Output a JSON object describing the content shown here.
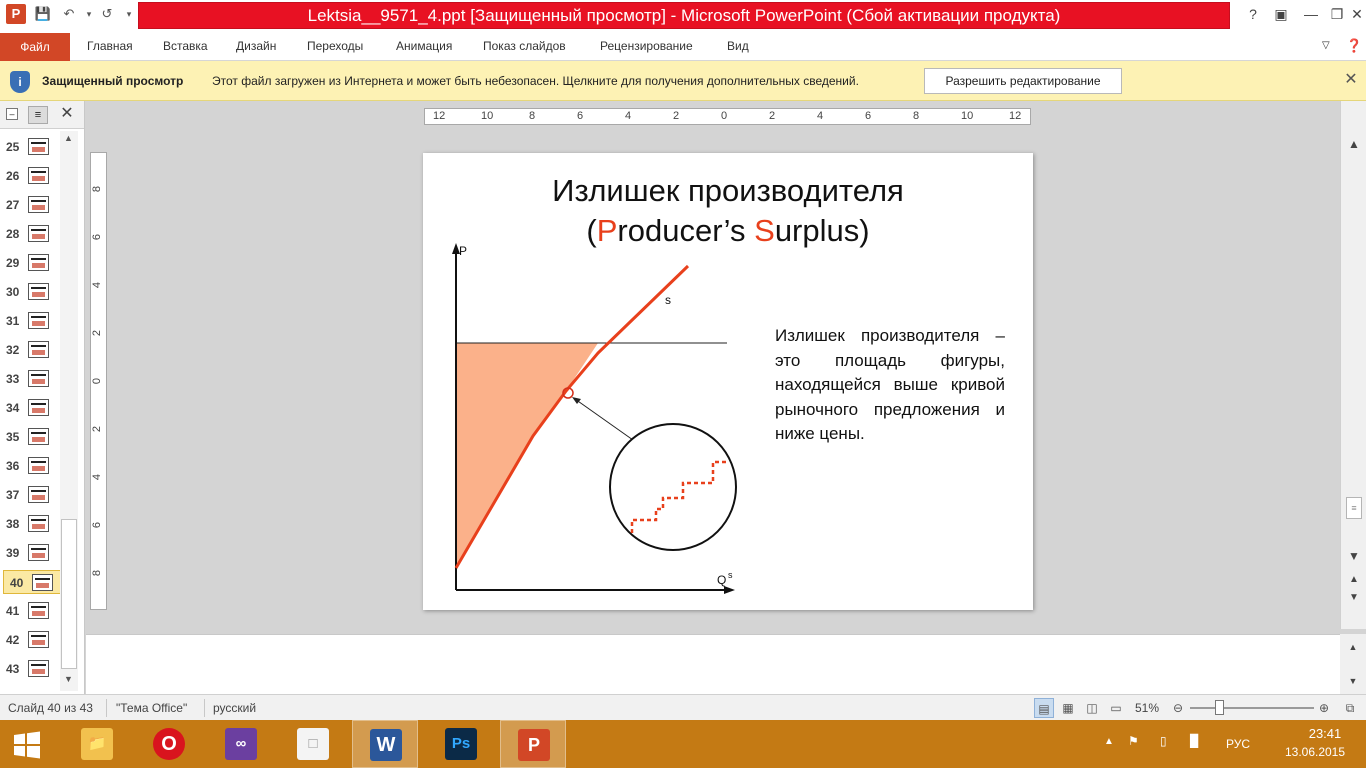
{
  "window": {
    "title": "Lektsia__9571_4.ppt [Защищенный просмотр] - Microsoft PowerPoint (Сбой активации продукта)",
    "app_icon_letter": "P"
  },
  "ribbon": {
    "file_tab": "Файл",
    "tabs": [
      "Главная",
      "Вставка",
      "Дизайн",
      "Переходы",
      "Анимация",
      "Показ слайдов",
      "Рецензирование",
      "Вид"
    ]
  },
  "protected_view": {
    "title": "Защищенный просмотр",
    "message": "Этот файл загружен из Интернета и может быть небезопасен. Щелкните для получения дополнительных сведений.",
    "button": "Разрешить редактирование"
  },
  "thumbnails": {
    "numbers": [
      "25",
      "26",
      "27",
      "28",
      "29",
      "30",
      "31",
      "32",
      "33",
      "34",
      "35",
      "36",
      "37",
      "38",
      "39",
      "40",
      "41",
      "42",
      "43"
    ],
    "selected": "40"
  },
  "ruler": {
    "h_labels": [
      "12",
      "10",
      "8",
      "6",
      "4",
      "2",
      "0",
      "2",
      "4",
      "6",
      "8",
      "10",
      "12"
    ],
    "v_labels": [
      "8",
      "6",
      "4",
      "2",
      "0",
      "2",
      "4",
      "6",
      "8"
    ]
  },
  "slide": {
    "title_line1": "Излишек производителя",
    "title_open": "(",
    "title_p": "P",
    "title_mid": "roducer’s ",
    "title_s": "S",
    "title_end": "urplus)",
    "body": "Излишек производителя – это площадь фигуры, находящейся выше кривой рыночного предложения и ниже цены.",
    "axis_p": "P",
    "axis_q": "Q",
    "axis_q_sup": "s",
    "curve_label": "s",
    "colors": {
      "curve": "#e8401c",
      "area": "#fbb18a"
    }
  },
  "status": {
    "slide_info": "Слайд 40 из 43",
    "theme": "\"Тема Office\"",
    "language": "русский",
    "zoom": "51%"
  },
  "taskbar": {
    "apps": [
      "explorer",
      "opera",
      "visual-studio",
      "file",
      "word",
      "photoshop",
      "powerpoint"
    ],
    "lang": "РУС",
    "time": "23:41",
    "date": "13.06.2015"
  }
}
